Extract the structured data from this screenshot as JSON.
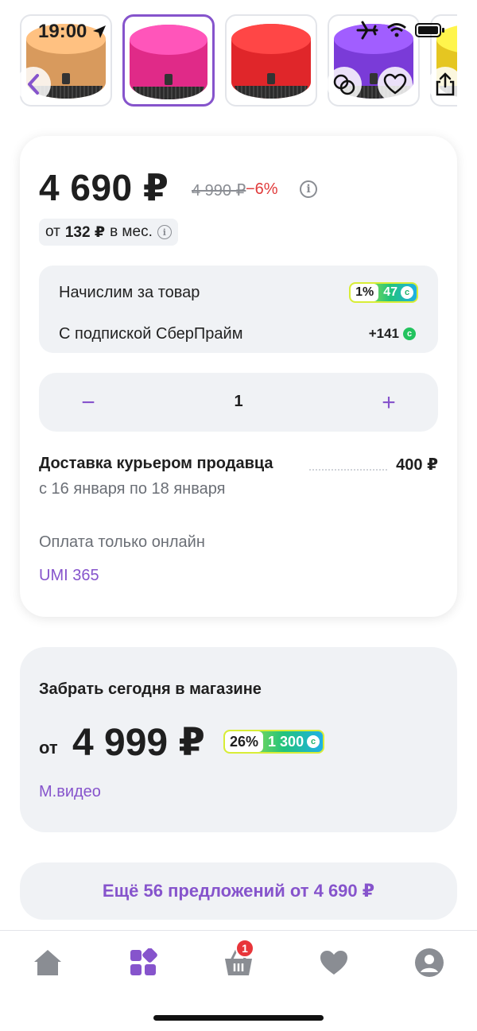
{
  "status_bar": {
    "time": "19:00"
  },
  "gallery": {
    "thumbnails": [
      {
        "color": "#d89a5d",
        "selected": false
      },
      {
        "color": "#e02a88",
        "selected": true
      },
      {
        "color": "#e0262a",
        "selected": false
      },
      {
        "color": "#7a3bd8",
        "selected": false
      },
      {
        "color": "#e5c621",
        "selected": false
      }
    ]
  },
  "product": {
    "price": "4 690 ₽",
    "old_price": "4 990 ₽",
    "discount": "−6%",
    "installment_prefix": "от",
    "installment_amount": "132 ₽",
    "installment_suffix": "в мес."
  },
  "bonuses": {
    "accrual_label": "Начислим за товар",
    "accrual_percent": "1%",
    "accrual_value": "47",
    "subscription_label": "С подпиской СберПрайм",
    "subscription_value": "+141"
  },
  "quantity": {
    "minus": "−",
    "value": "1",
    "plus": "+"
  },
  "delivery": {
    "title": "Доставка курьером продавца",
    "price": "400 ₽",
    "dates": "с 16 января по 18 января",
    "payment": "Оплата только онлайн",
    "seller": "UMI 365"
  },
  "store_pickup": {
    "title": "Забрать сегодня в магазине",
    "from": "от",
    "price": "4 999 ₽",
    "bonus_percent": "26%",
    "bonus_value": "1 300",
    "store_name": "М.видео"
  },
  "more_offers": {
    "label": "Ещё 56 предложений от 4 690 ₽"
  },
  "tabbar": {
    "cart_badge": "1"
  },
  "colors": {
    "accent": "#8654cc",
    "discount": "#e03a3a",
    "surface": "#f0f2f5"
  }
}
